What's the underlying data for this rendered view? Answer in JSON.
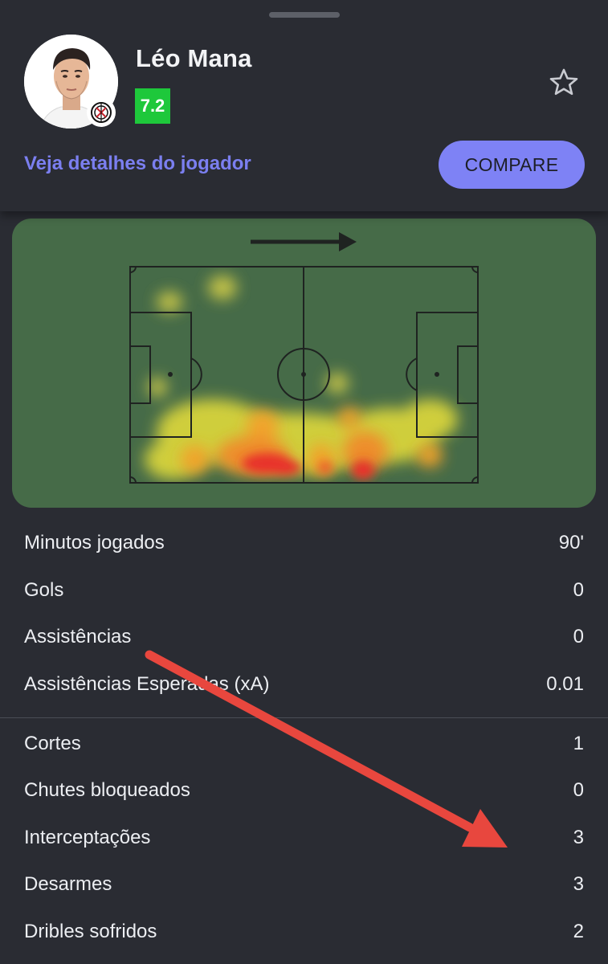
{
  "player": {
    "name": "Léo Mana",
    "rating": "7.2",
    "rating_color": "#1ec83b"
  },
  "actions": {
    "details_link": "Veja detalhes do jogador",
    "compare_label": "COMPARE",
    "favorite_icon": "star-outline-icon"
  },
  "heatmap": {
    "direction_icon": "arrow-right-icon",
    "pitch_color": "#466b48"
  },
  "stats_group_1": [
    {
      "label": "Minutos jogados",
      "value": "90'"
    },
    {
      "label": "Gols",
      "value": "0"
    },
    {
      "label": "Assistências",
      "value": "0"
    },
    {
      "label": "Assistências Esperadas (xA)",
      "value": "0.01"
    }
  ],
  "stats_group_2": [
    {
      "label": "Cortes",
      "value": "1"
    },
    {
      "label": "Chutes bloqueados",
      "value": "0"
    },
    {
      "label": "Interceptações",
      "value": "3"
    },
    {
      "label": "Desarmes",
      "value": "3"
    },
    {
      "label": "Dribles sofridos",
      "value": "2"
    }
  ],
  "colors": {
    "background": "#2a2c33",
    "accent": "#7e82f5",
    "annotation_arrow": "#e8473e"
  }
}
